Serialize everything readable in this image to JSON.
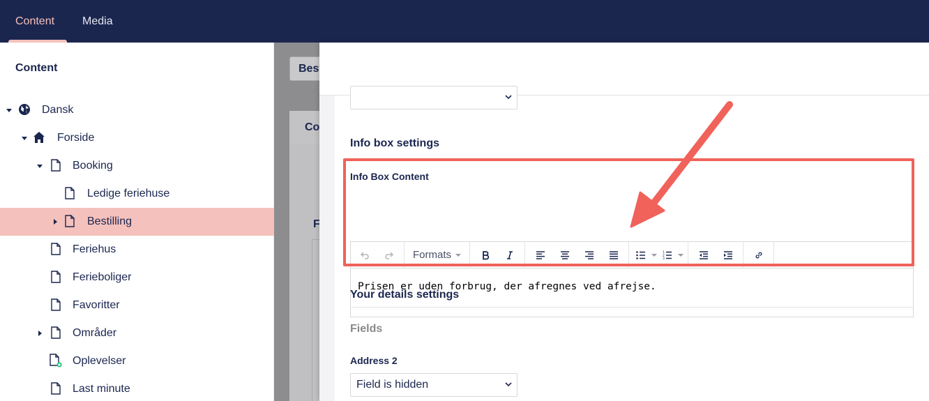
{
  "header": {
    "tabs": [
      {
        "label": "Content",
        "active": true
      },
      {
        "label": "Media",
        "active": false
      }
    ]
  },
  "sidebar": {
    "title": "Content",
    "tree": [
      {
        "label": "Dansk",
        "icon": "globe-icon",
        "caret": "down",
        "level": 0
      },
      {
        "label": "Forside",
        "icon": "home-icon",
        "caret": "down",
        "level": 1
      },
      {
        "label": "Booking",
        "icon": "document-icon",
        "caret": "down",
        "level": 2
      },
      {
        "label": "Ledige feriehuse",
        "icon": "document-icon",
        "caret": "",
        "level": 3
      },
      {
        "label": "Bestilling",
        "icon": "document-icon",
        "caret": "right",
        "level": 3,
        "active": true
      },
      {
        "label": "Feriehus",
        "icon": "document-icon",
        "caret": "",
        "level": 2
      },
      {
        "label": "Ferieboliger",
        "icon": "document-icon",
        "caret": "",
        "level": 2
      },
      {
        "label": "Favoritter",
        "icon": "document-icon",
        "caret": "",
        "level": 2
      },
      {
        "label": "Områder",
        "icon": "document-icon",
        "caret": "right",
        "level": 2
      },
      {
        "label": "Oplevelser",
        "icon": "document-plus-icon",
        "caret": "",
        "level": 2
      },
      {
        "label": "Last minute",
        "icon": "document-icon",
        "caret": "",
        "level": 2
      }
    ]
  },
  "background_editor": {
    "name_value": "Bestilling",
    "tab_label": "Content",
    "section_letter": "F"
  },
  "dialog": {
    "top_select_value": "",
    "info_box": {
      "section_title": "Info box settings",
      "property_label": "Info Box Content",
      "toolbar": {
        "formats_label": "Formats",
        "buttons": [
          "undo-icon",
          "redo-icon",
          "bold-icon",
          "italic-icon",
          "align-left-icon",
          "align-center-icon",
          "align-right-icon",
          "align-justify-icon",
          "bullet-list-icon",
          "numbered-list-icon",
          "outdent-icon",
          "indent-icon",
          "link-icon"
        ]
      },
      "content": "Prisen er uden forbrug, der afregnes ved afrejse."
    },
    "details": {
      "section_title": "Your details settings",
      "group_title": "Fields",
      "property_label": "Address 2",
      "select_value": "Field is hidden"
    }
  },
  "colors": {
    "header_bg": "#1b264f",
    "active_accent": "#f5c1bc",
    "highlight": "#f0625a",
    "text": "#1b264f"
  }
}
